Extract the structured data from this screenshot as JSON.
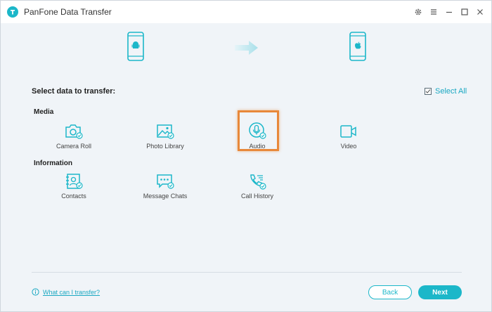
{
  "window": {
    "title": "PanFone Data Transfer"
  },
  "content": {
    "heading": "Select data to transfer:",
    "select_all_label": "Select All",
    "groups": [
      {
        "label": "Media",
        "items": [
          {
            "label": "Camera Roll",
            "icon": "camera-icon"
          },
          {
            "label": "Photo Library",
            "icon": "photo-icon"
          },
          {
            "label": "Audio",
            "icon": "microphone-icon",
            "highlighted": true
          },
          {
            "label": "Video",
            "icon": "video-icon"
          }
        ]
      },
      {
        "label": "Information",
        "items": [
          {
            "label": "Contacts",
            "icon": "contacts-icon"
          },
          {
            "label": "Message Chats",
            "icon": "message-icon"
          },
          {
            "label": "Call History",
            "icon": "phone-icon"
          }
        ]
      }
    ]
  },
  "footer": {
    "help_label": "What can I transfer?",
    "back_label": "Back",
    "next_label": "Next"
  },
  "colors": {
    "accent": "#1cb7c9",
    "highlight": "#e8883a",
    "background": "#f0f4f8"
  }
}
